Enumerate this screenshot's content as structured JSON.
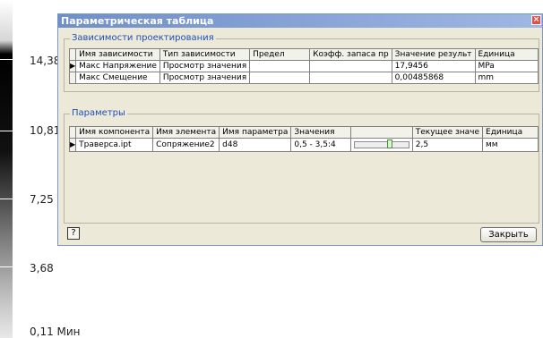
{
  "legend": {
    "labels": [
      "14,38",
      "10,81",
      "7,25",
      "3,68",
      "0,11 Мин"
    ]
  },
  "dialog": {
    "title": "Параметрическая таблица",
    "close_glyph": "×",
    "dependencies": {
      "group_label": "Зависимости проектирования",
      "columns": [
        "Имя зависимости",
        "Тип зависимости",
        "Предел",
        "Коэфф. запаса пр",
        "Значение результ",
        "Единица"
      ],
      "rows": [
        {
          "selected": true,
          "cells": [
            "Макс Напряжение",
            "Просмотр значения",
            "",
            "",
            "17,9456",
            "MPa"
          ]
        },
        {
          "selected": false,
          "cells": [
            "Макс Смещение",
            "Просмотр значения",
            "",
            "",
            "0,00485868",
            "mm"
          ]
        }
      ]
    },
    "parameters": {
      "group_label": "Параметры",
      "columns": [
        "Имя компонента",
        "Имя элемента",
        "Имя параметра",
        "Значения",
        "",
        "Текущее значе",
        "Единица"
      ],
      "rows": [
        {
          "selected": true,
          "component": "Траверса.ipt",
          "element": "Сопряжение2",
          "param": "d48",
          "values": "0,5 - 3,5:4",
          "slider_fraction": 0.67,
          "current": "2,5",
          "unit": "мм"
        }
      ]
    },
    "help_glyph": "?",
    "close_button_label": "Закрыть"
  }
}
